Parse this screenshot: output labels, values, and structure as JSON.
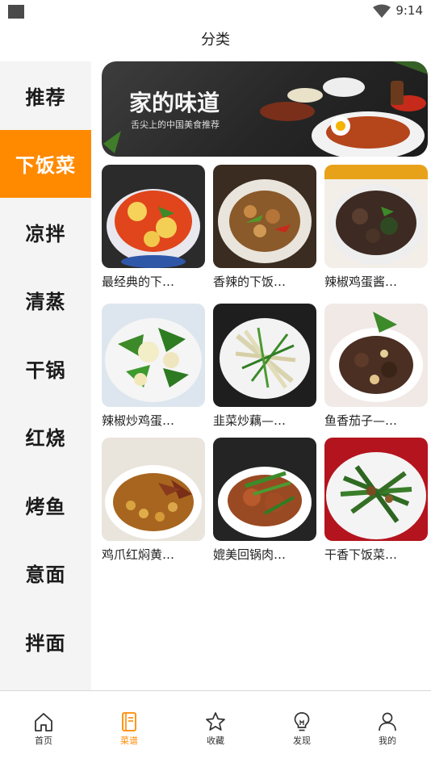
{
  "status_bar": {
    "time": "9:14"
  },
  "header": {
    "title": "分类"
  },
  "sidebar": {
    "items": [
      {
        "label": "推荐"
      },
      {
        "label": "下饭菜"
      },
      {
        "label": "凉拌"
      },
      {
        "label": "清蒸"
      },
      {
        "label": "干锅"
      },
      {
        "label": "红烧"
      },
      {
        "label": "烤鱼"
      },
      {
        "label": "意面"
      },
      {
        "label": "拌面"
      }
    ],
    "active_index": 1
  },
  "banner": {
    "title": "家的味道",
    "subtitle": "舌尖上的中国美食推荐"
  },
  "recipes": [
    {
      "label": "最经典的下…"
    },
    {
      "label": "香辣的下饭…"
    },
    {
      "label": "辣椒鸡蛋酱…"
    },
    {
      "label": "辣椒炒鸡蛋…"
    },
    {
      "label": "韭菜炒藕—…"
    },
    {
      "label": "鱼香茄子—…"
    },
    {
      "label": "鸡爪红焖黄…"
    },
    {
      "label": "媲美回锅肉…"
    },
    {
      "label": "干香下饭菜…"
    }
  ],
  "bottom_nav": {
    "items": [
      {
        "label": "首页",
        "icon": "home-icon"
      },
      {
        "label": "菜谱",
        "icon": "recipe-book-icon"
      },
      {
        "label": "收藏",
        "icon": "star-icon"
      },
      {
        "label": "发现",
        "icon": "lightbulb-icon"
      },
      {
        "label": "我的",
        "icon": "user-icon"
      }
    ],
    "active_index": 1
  },
  "colors": {
    "accent": "#ff8a00",
    "sidebar_bg": "#f4f4f4",
    "banner_bg": "#2b2b2b"
  }
}
